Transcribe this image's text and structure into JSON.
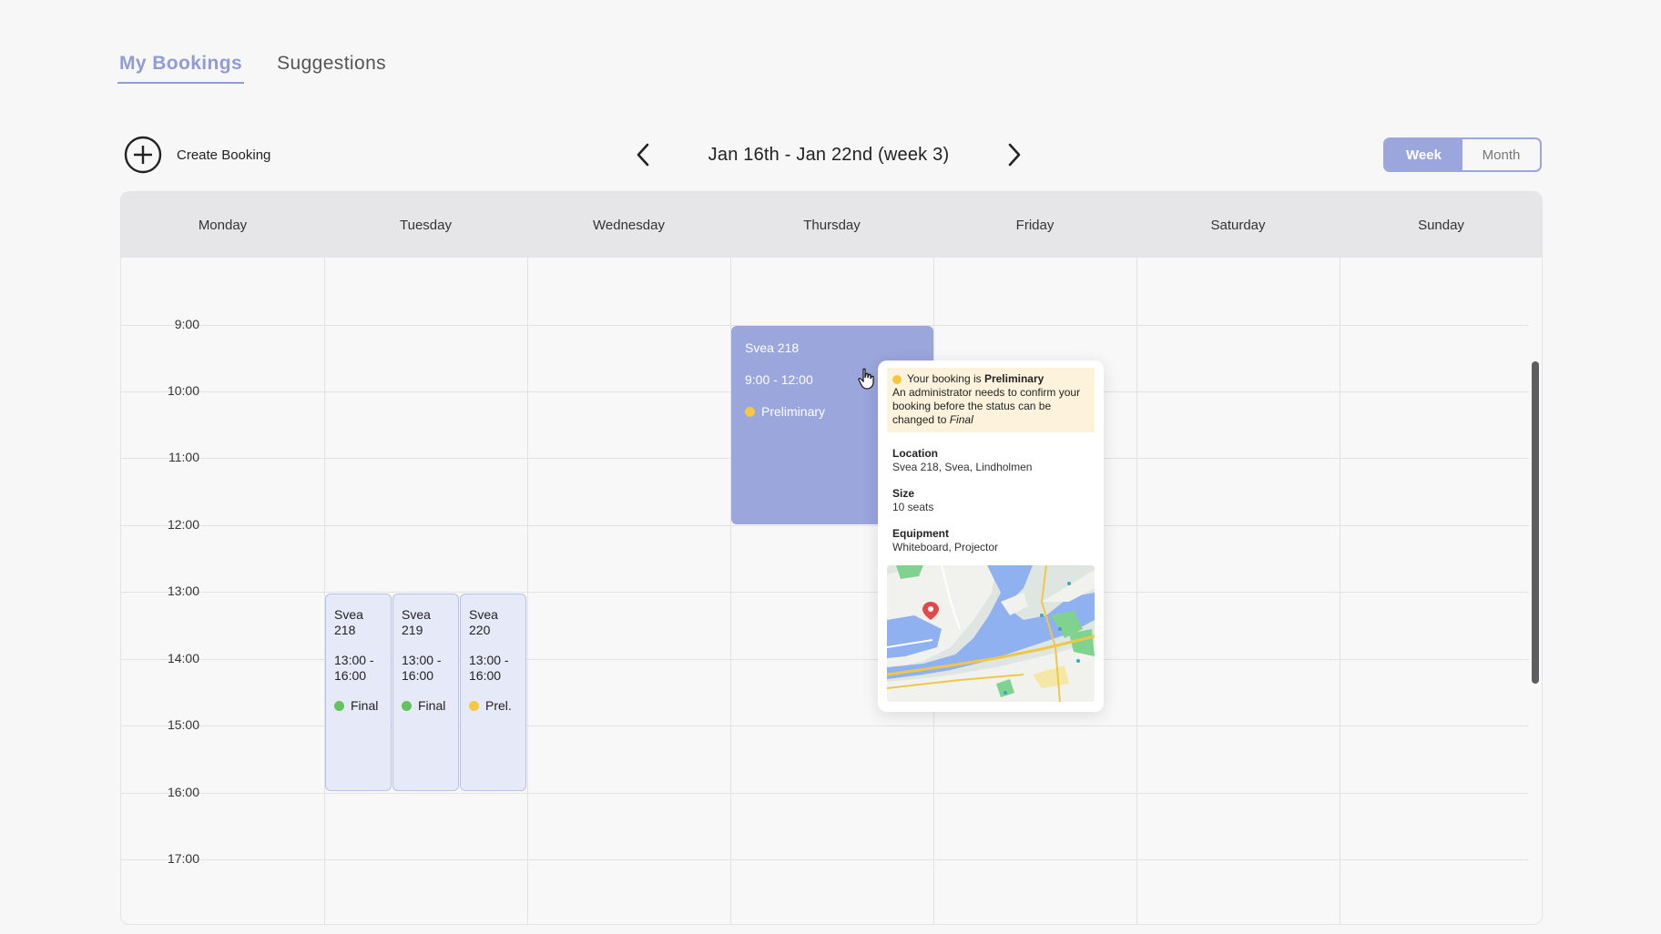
{
  "tabs": [
    {
      "label": "My Bookings",
      "active": true
    },
    {
      "label": "Suggestions",
      "active": false
    }
  ],
  "toolbar": {
    "create_label": "Create Booking",
    "range_label": "Jan 16th - Jan 22nd (week 3)",
    "views": [
      {
        "label": "Week",
        "active": true
      },
      {
        "label": "Month",
        "active": false
      }
    ]
  },
  "calendar": {
    "days": [
      "Monday",
      "Tuesday",
      "Wednesday",
      "Thursday",
      "Friday",
      "Saturday",
      "Sunday"
    ],
    "times": [
      "9:00",
      "10:00",
      "11:00",
      "12:00",
      "13:00",
      "14:00",
      "15:00",
      "16:00",
      "17:00"
    ]
  },
  "events": [
    {
      "day": "Thursday",
      "title": "Svea 218",
      "time": "9:00 - 12:00",
      "status": "Preliminary",
      "status_color": "#f5c842"
    },
    {
      "day": "Tuesday",
      "title_line1": "Svea",
      "title_line2": "218",
      "time_line1": "13:00 -",
      "time_line2": "16:00",
      "status": "Final",
      "status_color": "#62c45a"
    },
    {
      "day": "Tuesday",
      "title_line1": "Svea",
      "title_line2": "219",
      "time_line1": "13:00 -",
      "time_line2": "16:00",
      "status": "Final",
      "status_color": "#62c45a"
    },
    {
      "day": "Tuesday",
      "title_line1": "Svea",
      "title_line2": "220",
      "time_line1": "13:00 -",
      "time_line2": "16:00",
      "status": "Prel.",
      "status_color": "#f5c842"
    }
  ],
  "popover": {
    "notice_prefix": "Your booking is ",
    "notice_status": "Preliminary",
    "notice_body": "An administrator needs to confirm your booking before the status can be changed to ",
    "notice_final": "Final",
    "location_label": "Location",
    "location_value": "Svea 218, Svea, Lindholmen",
    "size_label": "Size",
    "size_value": "10 seats",
    "equipment_label": "Equipment",
    "equipment_value": "Whiteboard, Projector"
  },
  "colors": {
    "accent": "#9aa6dc",
    "preliminary": "#f5c842",
    "final": "#62c45a"
  }
}
